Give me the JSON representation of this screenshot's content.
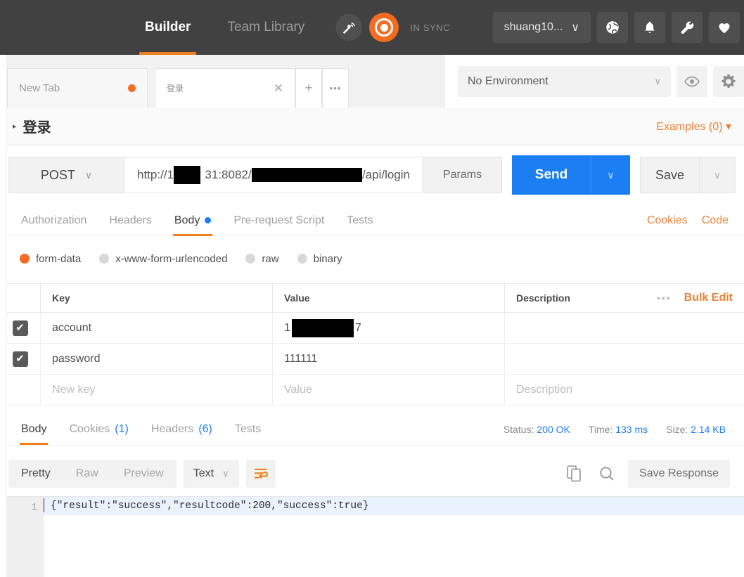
{
  "topbar": {
    "nav": [
      {
        "label": "Builder",
        "active": true
      },
      {
        "label": "Team Library",
        "active": false
      }
    ],
    "interceptor_icon": "satellite-dish-icon",
    "sync_icon": "sync-circle-icon",
    "sync_status": "IN SYNC",
    "user": {
      "name": "shuang10...",
      "caret": "∨"
    },
    "icons": [
      {
        "name": "globe-icon",
        "glyph": "●"
      },
      {
        "name": "bell-icon",
        "glyph": "●"
      },
      {
        "name": "wrench-icon",
        "glyph": "●"
      },
      {
        "name": "heart-icon",
        "glyph": "♥"
      }
    ],
    "accent": "#ef7f1a",
    "background": "#414141"
  },
  "tabs": {
    "items": [
      {
        "label": "New Tab",
        "active": false,
        "unsaved": true
      },
      {
        "label": "登录",
        "active": true,
        "unsaved": false,
        "close": "✕"
      }
    ],
    "new_tab_glyph": "+",
    "more_glyph": "•••"
  },
  "environment": {
    "selected": "No Environment",
    "caret": "∨",
    "eye_icon": "eye-icon",
    "gear_icon": "gear-icon"
  },
  "request": {
    "title": "登录",
    "collapse_caret": "▸",
    "examples_label": "Examples (0) ▾",
    "method": "POST",
    "method_caret": "∨",
    "url_prefix": "http://1",
    "url_mid": "31:8082/",
    "url_suffix": "/api/login",
    "params_label": "Params",
    "send_label": "Send",
    "send_caret": "∨",
    "save_label": "Save",
    "save_caret": "∨",
    "send_color": "#1b7ef2"
  },
  "request_tabs": {
    "items": [
      {
        "label": "Authorization",
        "active": false,
        "dot": false
      },
      {
        "label": "Headers",
        "active": false,
        "dot": false
      },
      {
        "label": "Body",
        "active": true,
        "dot": true
      },
      {
        "label": "Pre-request Script",
        "active": false,
        "dot": false
      },
      {
        "label": "Tests",
        "active": false,
        "dot": false
      }
    ],
    "cookies_label": "Cookies",
    "code_label": "Code"
  },
  "body_type": {
    "options": [
      {
        "label": "form-data",
        "selected": true
      },
      {
        "label": "x-www-form-urlencoded",
        "selected": false
      },
      {
        "label": "raw",
        "selected": false
      },
      {
        "label": "binary",
        "selected": false
      }
    ]
  },
  "kv_table": {
    "headers": {
      "key": "Key",
      "value": "Value",
      "description": "Description"
    },
    "dots": "•••",
    "bulk_edit": "Bulk Edit",
    "check_glyph": "✔",
    "rows": [
      {
        "checked": true,
        "key": "account",
        "value_prefix": "1",
        "value_suffix": "7",
        "redacted": true,
        "description": ""
      },
      {
        "checked": true,
        "key": "password",
        "value": "111111",
        "redacted": false,
        "description": ""
      }
    ],
    "placeholder_row": {
      "key": "New key",
      "value": "Value",
      "description": "Description"
    }
  },
  "response_tabs": {
    "items": [
      {
        "label": "Body",
        "count": "",
        "active": true
      },
      {
        "label": "Cookies",
        "count": "(1)",
        "active": false
      },
      {
        "label": "Headers",
        "count": "(6)",
        "active": false
      },
      {
        "label": "Tests",
        "count": "",
        "active": false
      }
    ],
    "status_label": "Status:",
    "status_value": "200 OK",
    "time_label": "Time:",
    "time_value": "133 ms",
    "size_label": "Size:",
    "size_value": "2.14 KB"
  },
  "response_toolbar": {
    "views": [
      {
        "label": "Pretty",
        "active": true
      },
      {
        "label": "Raw",
        "active": false
      },
      {
        "label": "Preview",
        "active": false
      }
    ],
    "format": "Text",
    "format_caret": "∨",
    "wrap_icon": "word-wrap-icon",
    "copy_icon": "copy-icon",
    "search_icon": "search-icon",
    "save_response_label": "Save Response"
  },
  "response_body": {
    "line_number": "1",
    "content": "{\"result\":\"success\",\"resultcode\":200,\"success\":true}"
  }
}
